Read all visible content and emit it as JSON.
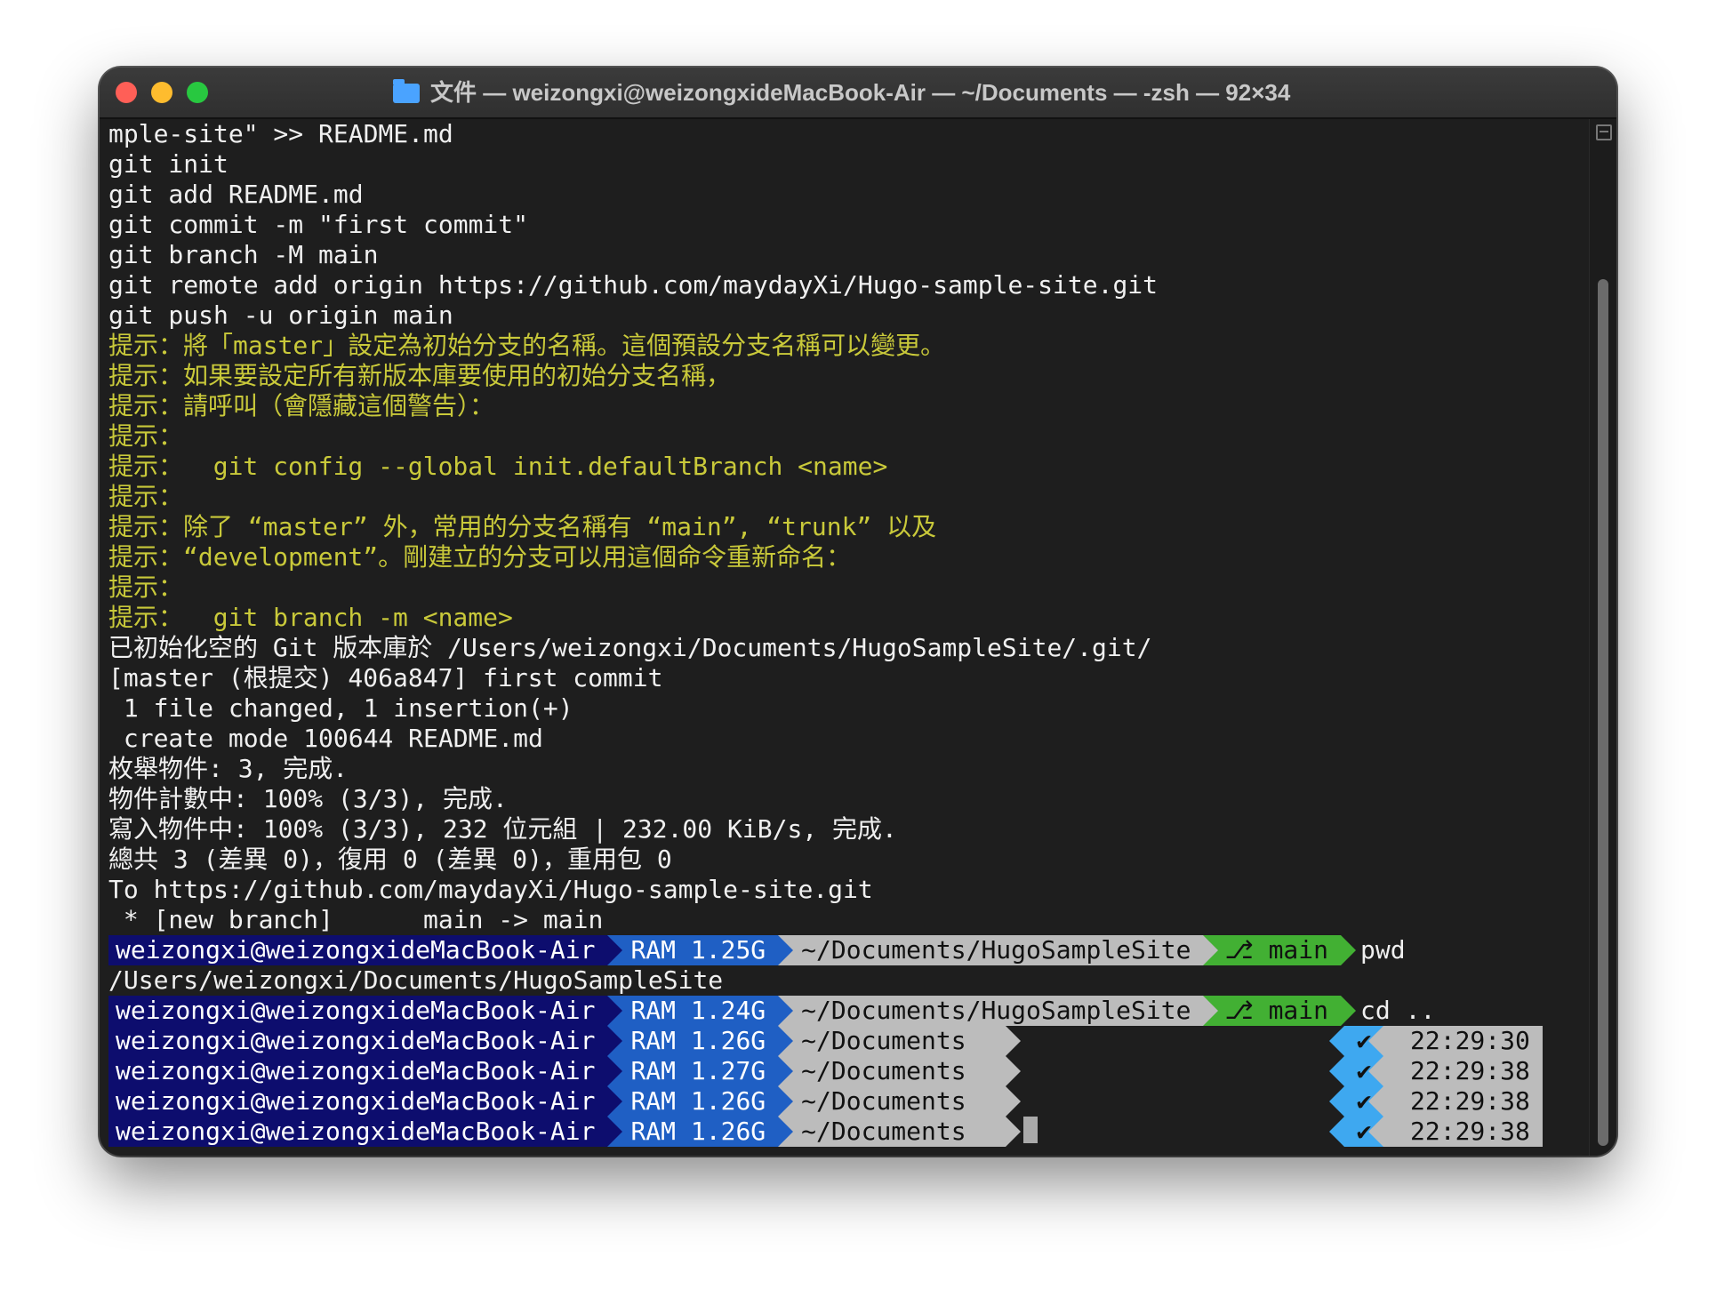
{
  "window": {
    "title": "文件 — weizongxi@weizongxideMacBook-Air — ~/Documents — -zsh — 92×34",
    "folder_icon": "folder-icon"
  },
  "output_lines": [
    {
      "text": "mple-site\" >> README.md",
      "style": "normal"
    },
    {
      "text": "git init",
      "style": "normal"
    },
    {
      "text": "git add README.md",
      "style": "normal"
    },
    {
      "text": "git commit -m \"first commit\"",
      "style": "normal"
    },
    {
      "text": "git branch -M main",
      "style": "normal"
    },
    {
      "text": "git remote add origin https://github.com/maydayXi/Hugo-sample-site.git",
      "style": "normal"
    },
    {
      "text": "git push -u origin main",
      "style": "normal"
    },
    {
      "text": "提示：將「master」設定為初始分支的名稱。這個預設分支名稱可以變更。",
      "style": "hint"
    },
    {
      "text": "提示：如果要設定所有新版本庫要使用的初始分支名稱，",
      "style": "hint"
    },
    {
      "text": "提示：請呼叫（會隱藏這個警告）：",
      "style": "hint"
    },
    {
      "text": "提示：",
      "style": "hint"
    },
    {
      "text": "提示：  git config --global init.defaultBranch <name>",
      "style": "hint"
    },
    {
      "text": "提示：",
      "style": "hint"
    },
    {
      "text": "提示：除了 “master” 外，常用的分支名稱有 “main”, “trunk” 以及",
      "style": "hint"
    },
    {
      "text": "提示：“development”。剛建立的分支可以用這個命令重新命名：",
      "style": "hint"
    },
    {
      "text": "提示：",
      "style": "hint"
    },
    {
      "text": "提示：  git branch -m <name>",
      "style": "hint"
    },
    {
      "text": "已初始化空的 Git 版本庫於 /Users/weizongxi/Documents/HugoSampleSite/.git/",
      "style": "normal"
    },
    {
      "text": "[master (根提交) 406a847] first commit",
      "style": "normal"
    },
    {
      "text": " 1 file changed, 1 insertion(+)",
      "style": "normal"
    },
    {
      "text": " create mode 100644 README.md",
      "style": "normal"
    },
    {
      "text": "枚舉物件: 3, 完成.",
      "style": "normal"
    },
    {
      "text": "物件計數中: 100% (3/3), 完成.",
      "style": "normal"
    },
    {
      "text": "寫入物件中: 100% (3/3), 232 位元組 | 232.00 KiB/s, 完成.",
      "style": "normal"
    },
    {
      "text": "總共 3 (差異 0)，復用 0 (差異 0)，重用包 0",
      "style": "normal"
    },
    {
      "text": "To https://github.com/maydayXi/Hugo-sample-site.git",
      "style": "normal"
    },
    {
      "text": " * [new branch]      main -> main",
      "style": "normal"
    }
  ],
  "prompts": [
    {
      "user": "weizongxi@weizongxideMacBook-Air",
      "ram": "RAM 1.25G",
      "dir": "~/Documents/HugoSampleSite",
      "git": "main",
      "cmd": "pwd"
    },
    {
      "user": "weizongxi@weizongxideMacBook-Air",
      "ram": "RAM 1.24G",
      "dir": "~/Documents/HugoSampleSite",
      "git": "main",
      "cmd": "cd .."
    },
    {
      "user": "weizongxi@weizongxideMacBook-Air",
      "ram": "RAM 1.26G",
      "dir": "~/Documents",
      "status": "✔",
      "time": "22:29:30"
    },
    {
      "user": "weizongxi@weizongxideMacBook-Air",
      "ram": "RAM 1.27G",
      "dir": "~/Documents",
      "status": "✔",
      "time": "22:29:38"
    },
    {
      "user": "weizongxi@weizongxideMacBook-Air",
      "ram": "RAM 1.26G",
      "dir": "~/Documents",
      "status": "✔",
      "time": "22:29:38"
    },
    {
      "user": "weizongxi@weizongxideMacBook-Air",
      "ram": "RAM 1.26G",
      "dir": "~/Documents",
      "status": "✔",
      "time": "22:29:38"
    }
  ],
  "pwd_output": "/Users/weizongxi/Documents/HugoSampleSite",
  "git_branch_icon": "git-branch-icon",
  "colors": {
    "hint": "#c9c93a",
    "user_seg": "#0d0d6e",
    "ram_seg": "#1f5fc4",
    "dir_seg": "#bcbcbc",
    "git_seg": "#42b033",
    "ok_seg": "#3ea8f0"
  }
}
